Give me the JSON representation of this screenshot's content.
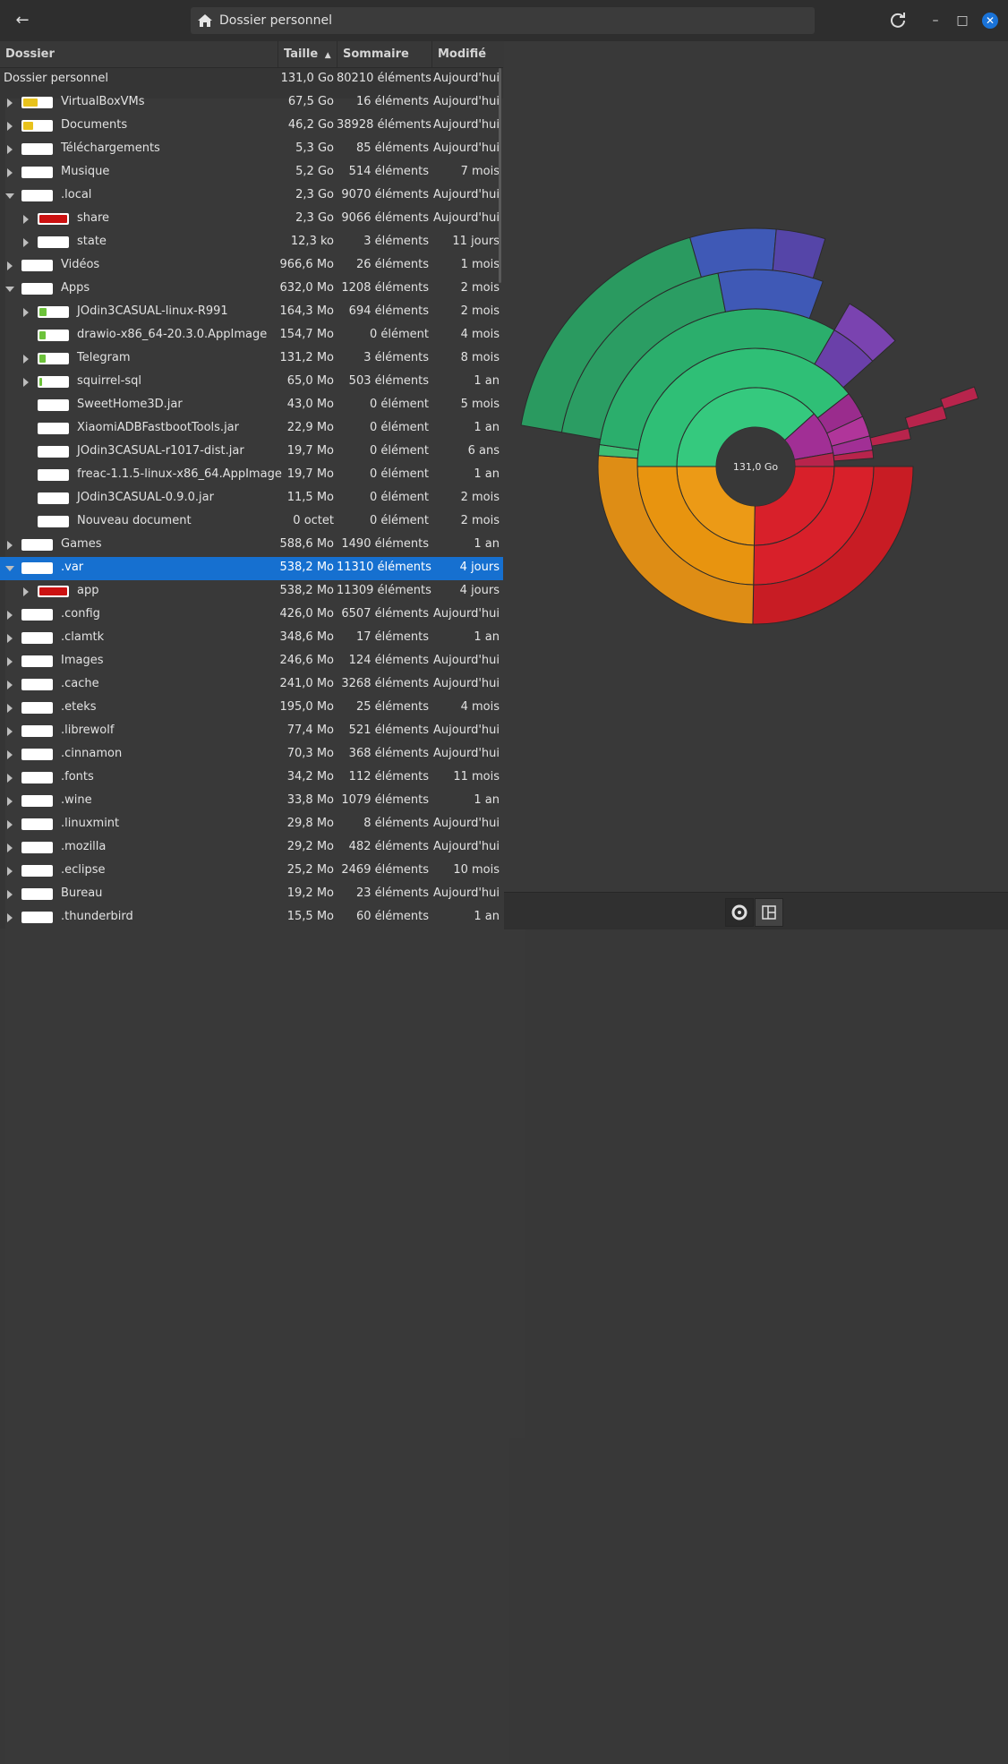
{
  "window": {
    "path": "Dossier personnel"
  },
  "columns": {
    "folder": "Dossier",
    "size": "Taille",
    "count": "Sommaire",
    "modified": "Modifié"
  },
  "root": {
    "name": "Dossier personnel",
    "size": "131,0 Go",
    "count": "80210 éléments",
    "modified": "Aujourd'hui"
  },
  "rows": [
    {
      "name": "VirtualBoxVMs",
      "size": "67,5 Go",
      "count": "16 éléments",
      "modified": "Aujourd'hui",
      "level": 0,
      "expander": "right",
      "fill": 0.52,
      "color": "#e8c21c"
    },
    {
      "name": "Documents",
      "size": "46,2 Go",
      "count": "38928 éléments",
      "modified": "Aujourd'hui",
      "level": 0,
      "expander": "right",
      "fill": 0.35,
      "color": "#e8c21c"
    },
    {
      "name": "Téléchargements",
      "size": "5,3 Go",
      "count": "85 éléments",
      "modified": "Aujourd'hui",
      "level": 0,
      "expander": "right",
      "fill": 0.0,
      "color": "#e8c21c"
    },
    {
      "name": "Musique",
      "size": "5,2 Go",
      "count": "514 éléments",
      "modified": "7 mois",
      "level": 0,
      "expander": "right",
      "fill": 0.0,
      "color": "#e8c21c"
    },
    {
      "name": ".local",
      "size": "2,3 Go",
      "count": "9070 éléments",
      "modified": "Aujourd'hui",
      "level": 0,
      "expander": "down",
      "fill": 0.0,
      "color": "#e8c21c"
    },
    {
      "name": "share",
      "size": "2,3 Go",
      "count": "9066 éléments",
      "modified": "Aujourd'hui",
      "level": 1,
      "expander": "right",
      "fill": 0.998,
      "color": "#cc1111"
    },
    {
      "name": "state",
      "size": "12,3 ko",
      "count": "3 éléments",
      "modified": "11 jours",
      "level": 1,
      "expander": "right",
      "fill": 0.0,
      "color": "#cc1111"
    },
    {
      "name": "Vidéos",
      "size": "966,6 Mo",
      "count": "26 éléments",
      "modified": "1 mois",
      "level": 0,
      "expander": "right",
      "fill": 0.0,
      "color": "#e8c21c"
    },
    {
      "name": "Apps",
      "size": "632,0 Mo",
      "count": "1208 éléments",
      "modified": "2 mois",
      "level": 0,
      "expander": "down",
      "fill": 0.0,
      "color": "#e8c21c"
    },
    {
      "name": "JOdin3CASUAL-linux-R991",
      "size": "164,3 Mo",
      "count": "694 éléments",
      "modified": "2 mois",
      "level": 1,
      "expander": "right",
      "fill": 0.26,
      "color": "#6cc23a"
    },
    {
      "name": "drawio-x86_64-20.3.0.AppImage",
      "size": "154,7 Mo",
      "count": "0 élément",
      "modified": "4 mois",
      "level": 1,
      "expander": "none",
      "fill": 0.24,
      "color": "#6cc23a"
    },
    {
      "name": "Telegram",
      "size": "131,2 Mo",
      "count": "3 éléments",
      "modified": "8 mois",
      "level": 1,
      "expander": "right",
      "fill": 0.21,
      "color": "#6cc23a"
    },
    {
      "name": "squirrel-sql",
      "size": "65,0 Mo",
      "count": "503 éléments",
      "modified": "1 an",
      "level": 1,
      "expander": "right",
      "fill": 0.1,
      "color": "#6cc23a"
    },
    {
      "name": "SweetHome3D.jar",
      "size": "43,0 Mo",
      "count": "0 élément",
      "modified": "5 mois",
      "level": 1,
      "expander": "none",
      "fill": 0.0,
      "color": "#6cc23a"
    },
    {
      "name": "XiaomiADBFastbootTools.jar",
      "size": "22,9 Mo",
      "count": "0 élément",
      "modified": "1 an",
      "level": 1,
      "expander": "none",
      "fill": 0.0,
      "color": "#6cc23a"
    },
    {
      "name": "JOdin3CASUAL-r1017-dist.jar",
      "size": "19,7 Mo",
      "count": "0 élément",
      "modified": "6 ans",
      "level": 1,
      "expander": "none",
      "fill": 0.0,
      "color": "#6cc23a"
    },
    {
      "name": "freac-1.1.5-linux-x86_64.AppImage",
      "size": "19,7 Mo",
      "count": "0 élément",
      "modified": "1 an",
      "level": 1,
      "expander": "none",
      "fill": 0.0,
      "color": "#6cc23a"
    },
    {
      "name": "JOdin3CASUAL-0.9.0.jar",
      "size": "11,5 Mo",
      "count": "0 élément",
      "modified": "2 mois",
      "level": 1,
      "expander": "none",
      "fill": 0.0,
      "color": "#6cc23a"
    },
    {
      "name": "Nouveau document",
      "size": "0 octet",
      "count": "0 élément",
      "modified": "2 mois",
      "level": 1,
      "expander": "none",
      "fill": 0.0,
      "color": "#6cc23a"
    },
    {
      "name": "Games",
      "size": "588,6 Mo",
      "count": "1490 éléments",
      "modified": "1 an",
      "level": 0,
      "expander": "right",
      "fill": 0.0,
      "color": "#e8c21c"
    },
    {
      "name": ".var",
      "size": "538,2 Mo",
      "count": "11310 éléments",
      "modified": "4 jours",
      "level": 0,
      "expander": "down",
      "fill": 0.0,
      "color": "#e8c21c",
      "selected": true
    },
    {
      "name": "app",
      "size": "538,2 Mo",
      "count": "11309 éléments",
      "modified": "4 jours",
      "level": 1,
      "expander": "right",
      "fill": 0.998,
      "color": "#cc1111"
    },
    {
      "name": ".config",
      "size": "426,0 Mo",
      "count": "6507 éléments",
      "modified": "Aujourd'hui",
      "level": 0,
      "expander": "right",
      "fill": 0.0,
      "color": "#e8c21c"
    },
    {
      "name": ".clamtk",
      "size": "348,6 Mo",
      "count": "17 éléments",
      "modified": "1 an",
      "level": 0,
      "expander": "right",
      "fill": 0.0,
      "color": "#e8c21c"
    },
    {
      "name": "Images",
      "size": "246,6 Mo",
      "count": "124 éléments",
      "modified": "Aujourd'hui",
      "level": 0,
      "expander": "right",
      "fill": 0.0,
      "color": "#e8c21c"
    },
    {
      "name": ".cache",
      "size": "241,0 Mo",
      "count": "3268 éléments",
      "modified": "Aujourd'hui",
      "level": 0,
      "expander": "right",
      "fill": 0.0,
      "color": "#e8c21c"
    },
    {
      "name": ".eteks",
      "size": "195,0 Mo",
      "count": "25 éléments",
      "modified": "4 mois",
      "level": 0,
      "expander": "right",
      "fill": 0.0,
      "color": "#e8c21c"
    },
    {
      "name": ".librewolf",
      "size": "77,4 Mo",
      "count": "521 éléments",
      "modified": "Aujourd'hui",
      "level": 0,
      "expander": "right",
      "fill": 0.0,
      "color": "#e8c21c"
    },
    {
      "name": ".cinnamon",
      "size": "70,3 Mo",
      "count": "368 éléments",
      "modified": "Aujourd'hui",
      "level": 0,
      "expander": "right",
      "fill": 0.0,
      "color": "#e8c21c"
    },
    {
      "name": ".fonts",
      "size": "34,2 Mo",
      "count": "112 éléments",
      "modified": "11 mois",
      "level": 0,
      "expander": "right",
      "fill": 0.0,
      "color": "#e8c21c"
    },
    {
      "name": ".wine",
      "size": "33,8 Mo",
      "count": "1079 éléments",
      "modified": "1 an",
      "level": 0,
      "expander": "right",
      "fill": 0.0,
      "color": "#e8c21c"
    },
    {
      "name": ".linuxmint",
      "size": "29,8 Mo",
      "count": "8 éléments",
      "modified": "Aujourd'hui",
      "level": 0,
      "expander": "right",
      "fill": 0.0,
      "color": "#e8c21c"
    },
    {
      "name": ".mozilla",
      "size": "29,2 Mo",
      "count": "482 éléments",
      "modified": "Aujourd'hui",
      "level": 0,
      "expander": "right",
      "fill": 0.0,
      "color": "#e8c21c"
    },
    {
      "name": ".eclipse",
      "size": "25,2 Mo",
      "count": "2469 éléments",
      "modified": "10 mois",
      "level": 0,
      "expander": "right",
      "fill": 0.0,
      "color": "#e8c21c"
    },
    {
      "name": "Bureau",
      "size": "19,2 Mo",
      "count": "23 éléments",
      "modified": "Aujourd'hui",
      "level": 0,
      "expander": "right",
      "fill": 0.0,
      "color": "#e8c21c"
    },
    {
      "name": ".thunderbird",
      "size": "15,5 Mo",
      "count": "60 éléments",
      "modified": "1 an",
      "level": 0,
      "expander": "right",
      "fill": 0.0,
      "color": "#e8c21c"
    }
  ],
  "ringchart": {
    "center_label": "131,0 Go",
    "colors": {
      "red": "#d8202a",
      "orange": "#ec9a16",
      "green": "#2ea86e",
      "blue": "#3d56b4",
      "purple": "#6b3fa8",
      "magenta": "#9a2b8e",
      "crimson": "#b51e4a"
    }
  },
  "chart_data": {
    "type": "sunburst",
    "center_label": "131,0 Go",
    "rings": [
      {
        "level": 1,
        "segments": [
          {
            "color": "red",
            "start": 0,
            "end": 180
          },
          {
            "color": "orange",
            "start": 180,
            "end": 268
          },
          {
            "color": "green",
            "start": 268,
            "end": 278
          },
          {
            "color": "green",
            "start": 278,
            "end": 378
          },
          {
            "color": "magenta",
            "start": 378,
            "end": 420
          },
          {
            "color": "crimson",
            "start": 420,
            "end": 442
          }
        ]
      },
      {
        "level": 2,
        "segments": [
          {
            "color": "red",
            "start": 0,
            "end": 180
          },
          {
            "color": "orange",
            "start": 180,
            "end": 268
          },
          {
            "color": "green",
            "start": 268,
            "end": 278
          },
          {
            "color": "green",
            "start": 278,
            "end": 375
          },
          {
            "color": "magenta",
            "start": 375,
            "end": 420
          }
        ]
      }
    ]
  }
}
